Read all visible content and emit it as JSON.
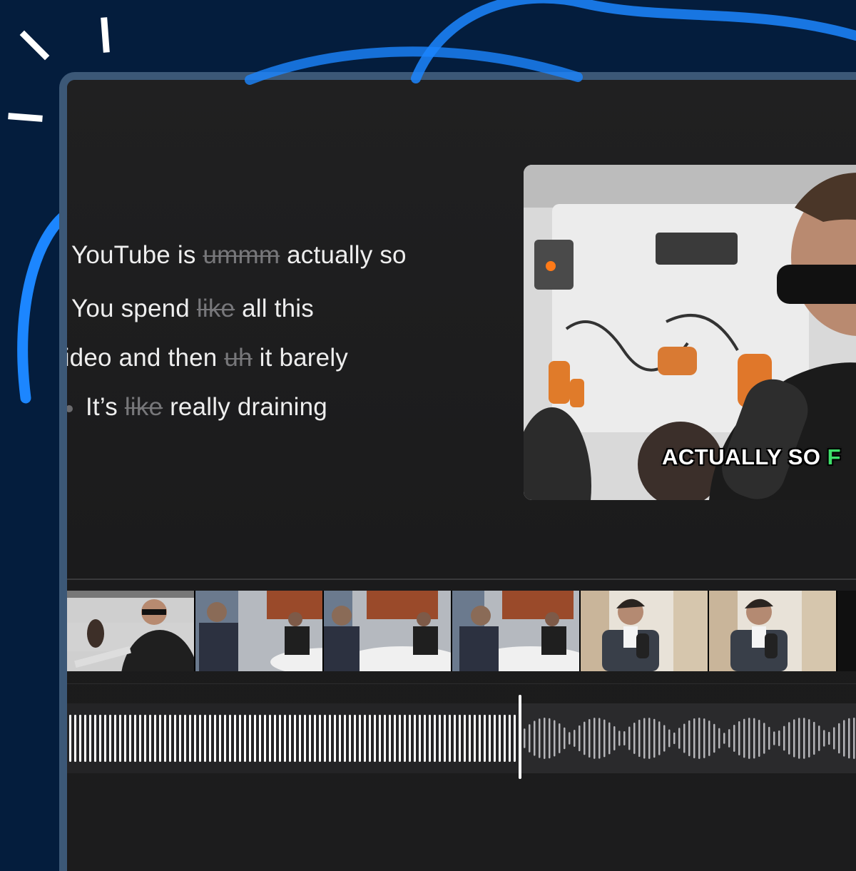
{
  "transcript": {
    "lines": [
      {
        "before": "YouTube is ",
        "filler": "ummm",
        "after": " actually so",
        "bullet": false
      },
      {
        "before": "You spend ",
        "filler": "like",
        "after": " all this",
        "bullet": false
      },
      {
        "before": "video and then ",
        "filler": "uh",
        "after": " it barely",
        "bullet": false
      },
      {
        "before": "It’s ",
        "filler": "like",
        "after": " really draining",
        "bullet": true
      }
    ]
  },
  "preview": {
    "caption_main": "ACTUALLY SO ",
    "caption_highlight": "F",
    "caption_highlight_color": "#3ee06a"
  },
  "timeline": {
    "filmstrip_thumbnails": 6,
    "playhead_progress": 0.56
  },
  "colors": {
    "background": "#041d3d",
    "window_frame": "#3c5877",
    "accent_arc": "#1c86ff",
    "text": "#eeeeee",
    "filler_text": "#77777a"
  }
}
